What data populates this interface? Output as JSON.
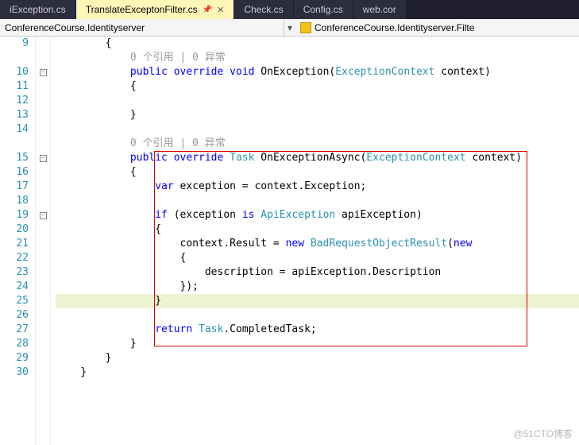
{
  "tabs": {
    "t0": "iException.cs",
    "t1": "TranslateExceptonFilter.cs",
    "t2": "Check.cs",
    "t3": "Config.cs",
    "t4": "web.cor",
    "pin": "📌",
    "close": "✕"
  },
  "breadcrumb": {
    "left": "ConferenceCourse.Identityserver",
    "right": "ConferenceCourse.Identityserver.Filte",
    "drop": "▾"
  },
  "codelens": {
    "a": "0 个引用 | 0 异常",
    "b": "0 个引用 | 0 异常"
  },
  "ln": {
    "l9": "9",
    "l10": "10",
    "l11": "11",
    "l12": "12",
    "l13": "13",
    "l14": "14",
    "l15": "15",
    "l16": "16",
    "l17": "17",
    "l18": "18",
    "l19": "19",
    "l20": "20",
    "l21": "21",
    "l22": "22",
    "l23": "23",
    "l24": "24",
    "l25": "25",
    "l26": "26",
    "l27": "27",
    "l28": "28",
    "l29": "29",
    "l30": "30"
  },
  "fold": {
    "minus": "−"
  },
  "code": {
    "l9": "        {",
    "l10_a": "            ",
    "l10_kw1": "public",
    "l10_s1": " ",
    "l10_kw2": "override",
    "l10_s2": " ",
    "l10_kw3": "void",
    "l10_s3": " OnException(",
    "l10_ty": "ExceptionContext",
    "l10_s4": " context)",
    "l11": "            {",
    "l12": "",
    "l13": "            }",
    "l14": "",
    "l15_a": "            ",
    "l15_kw1": "public",
    "l15_s1": " ",
    "l15_kw2": "override",
    "l15_s2": " ",
    "l15_ty1": "Task",
    "l15_s3": " OnExceptionAsync(",
    "l15_ty2": "ExceptionContext",
    "l15_s4": " context)",
    "l16": "            {",
    "l17_a": "                ",
    "l17_kw": "var",
    "l17_b": " exception = context.Exception;",
    "l18": "",
    "l19_a": "                ",
    "l19_kw1": "if",
    "l19_b": " (exception ",
    "l19_kw2": "is",
    "l19_c": " ",
    "l19_ty": "ApiException",
    "l19_d": " apiException)",
    "l20": "                {",
    "l21_a": "                    context.Result = ",
    "l21_kw": "new",
    "l21_b": " ",
    "l21_ty": "BadRequestObjectResult",
    "l21_c": "(",
    "l21_kw2": "new",
    "l22": "                    {",
    "l23": "                        description = apiException.Description",
    "l24": "                    });",
    "l25": "                }",
    "l26": "",
    "l27_a": "                ",
    "l27_kw": "return",
    "l27_b": " ",
    "l27_ty": "Task",
    "l27_c": ".CompletedTask;",
    "l28": "            }",
    "l29": "        }",
    "l30": "    }"
  },
  "watermark": "@51CTO博客"
}
